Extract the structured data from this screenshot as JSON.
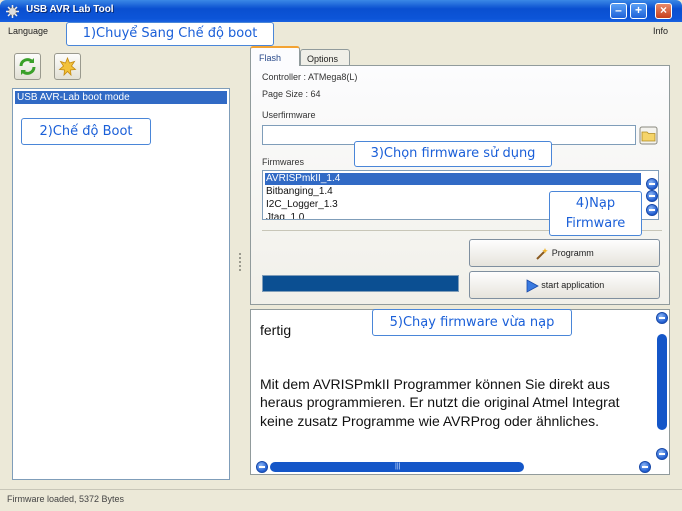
{
  "window": {
    "title": "USB AVR Lab Tool"
  },
  "menu": {
    "left": "Language",
    "right": "Info"
  },
  "devices": [
    "USB AVR-Lab boot mode"
  ],
  "tabs": [
    {
      "label": "Flash"
    },
    {
      "label": "Options"
    }
  ],
  "flash": {
    "controller": "Controller : ATMega8(L)",
    "page_size": "Page Size : 64",
    "userfirmware_label": "Userfirmware",
    "userfirmware_value": "",
    "firmwares_label": "Firmwares",
    "firmwares": [
      "AVRISPmkII_1.4",
      "Bitbanging_1.4",
      "I2C_Logger_1.3",
      "Jtag_1.0"
    ],
    "selected_index": 0,
    "program_label": "Programm",
    "start_label": "start application",
    "progress_fraction": 1.0
  },
  "log": {
    "line1": "fertig",
    "line2": "Mit dem AVRISPmkII Programmer können Sie direkt aus",
    "line3": "heraus programmieren. Er nutzt die original Atmel Integrat",
    "line4": "keine zusatz Programme wie AVRProg oder ähnliches."
  },
  "status": {
    "text": "Firmware loaded, 5372 Bytes"
  },
  "callouts": {
    "c1": "1)Chuyể Sang Chế độ boot",
    "c2": "2)Chế độ Boot",
    "c3": "3)Chọn firmware sử dụng",
    "c4a": "4)Nạp",
    "c4b": "Firmware",
    "c5": "5)Chạy firmware vừa nạp"
  },
  "colors": {
    "accent": "#316ac5",
    "titlebar": "#0a4fd0",
    "callout": "#1a5fd8"
  },
  "icons": {
    "refresh": "refresh-icon",
    "boot": "boot-icon",
    "program": "wand-icon",
    "start": "play-icon",
    "browse": "folder-icon"
  }
}
